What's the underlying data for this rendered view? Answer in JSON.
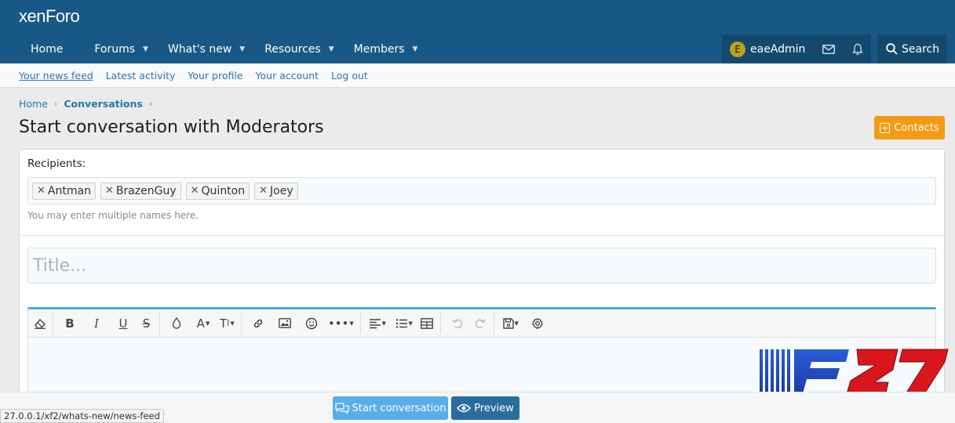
{
  "brand": {
    "logo_text": "xenForo"
  },
  "nav": {
    "items": [
      {
        "label": "Home"
      },
      {
        "label": "Forums"
      },
      {
        "label": "What's new"
      },
      {
        "label": "Resources"
      },
      {
        "label": "Members"
      }
    ]
  },
  "user": {
    "avatar_letter": "E",
    "name": "eaeAdmin"
  },
  "search": {
    "label": "Search"
  },
  "subnav": {
    "items": [
      {
        "label": "Your news feed"
      },
      {
        "label": "Latest activity"
      },
      {
        "label": "Your profile"
      },
      {
        "label": "Your account"
      },
      {
        "label": "Log out"
      }
    ]
  },
  "breadcrumb": {
    "home": "Home",
    "current": "Conversations"
  },
  "page": {
    "title": "Start conversation with Moderators",
    "contacts_label": "Contacts"
  },
  "form": {
    "recipients_label": "Recipients:",
    "recipients": [
      "Antman",
      "BrazenGuy",
      "Quinton",
      "Joey"
    ],
    "recipients_hint": "You may enter multiple names here.",
    "title_placeholder": "Title..."
  },
  "actions": {
    "start_label": "Start conversation",
    "preview_label": "Preview"
  },
  "status_bar": {
    "url": "27.0.0.1/xf2/whats-new/news-feed"
  },
  "watermark": {
    "text": "F27"
  },
  "colors": {
    "header": "#185886",
    "accent": "#47a7eb",
    "contacts_button": "#f39c13",
    "start_button": "#5aade9",
    "preview_button": "#2a6d9c"
  }
}
